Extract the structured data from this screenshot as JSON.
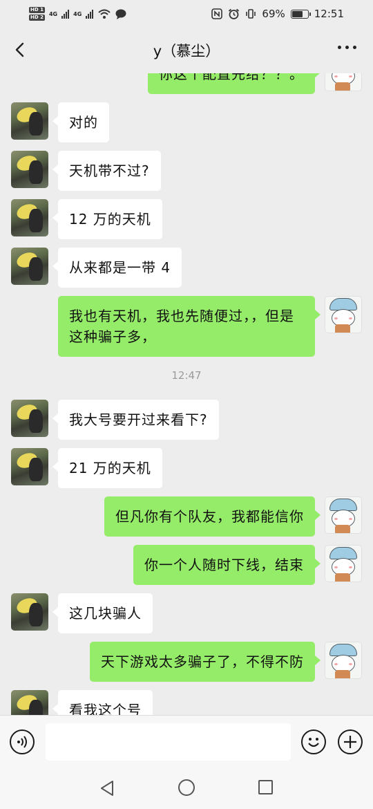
{
  "status_bar": {
    "sim1": "HD 1",
    "sim2": "HD 2",
    "network1": "4G",
    "network2": "4G",
    "battery_percent": "69%",
    "battery_level": 0.69,
    "time": "12:51",
    "icons": [
      "nfc-icon",
      "alarm-icon",
      "vibrate-icon",
      "battery-icon",
      "wifi-icon",
      "message-notification-icon"
    ]
  },
  "header": {
    "title": "y（慕尘）",
    "back_icon": "chevron-left-icon",
    "more_icon": "more-dots-icon"
  },
  "messages": [
    {
      "side": "right",
      "text": "你这个配置先给？？。"
    },
    {
      "side": "left",
      "text": "对的"
    },
    {
      "side": "left",
      "text": "天机带不过?"
    },
    {
      "side": "left",
      "text": "12 万的天机"
    },
    {
      "side": "left",
      "text": "从来都是一带 4"
    },
    {
      "side": "right",
      "text": "我也有天机，我也先随便过，，但是这种骗子多，"
    },
    {
      "side": "left",
      "text": "我大号要开过来看下?"
    },
    {
      "side": "left",
      "text": "21 万的天机"
    },
    {
      "side": "right",
      "text": "但凡你有个队友，我都能信你"
    },
    {
      "side": "right",
      "text": "你一个人随时下线，结束"
    },
    {
      "side": "left",
      "text": "这几块骗人"
    },
    {
      "side": "right",
      "text": "天下游戏太多骗子了，不得不防"
    },
    {
      "side": "left",
      "text": "看我这个号"
    }
  ],
  "timestamp": "12:47",
  "input_bar": {
    "voice_icon": "voice-icon",
    "emoji_icon": "emoji-icon",
    "plus_icon": "plus-icon",
    "text_value": ""
  },
  "nav_bar": {
    "back_icon": "nav-back-icon",
    "home_icon": "nav-home-icon",
    "recent_icon": "nav-recent-icon"
  },
  "colors": {
    "background": "#ededed",
    "friend_bubble": "#ffffff",
    "my_bubble": "#95ec69"
  }
}
